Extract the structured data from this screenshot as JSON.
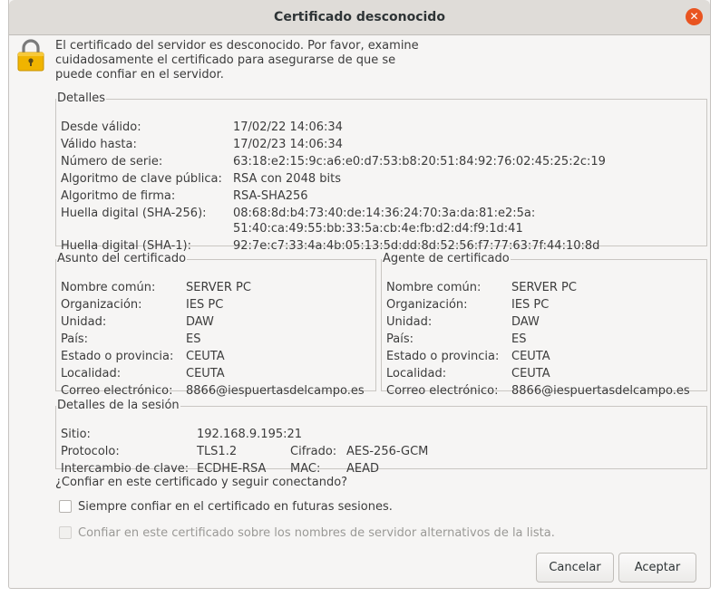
{
  "window": {
    "title": "Certificado desconocido"
  },
  "intro": [
    "El certificado del servidor es desconocido. Por favor, examine",
    "cuidadosamente el certificado para asegurarse de que se",
    "puede confiar en el servidor."
  ],
  "details": {
    "legend": "Detalles",
    "rows": [
      {
        "label": "Desde válido:",
        "value": "17/02/22 14:06:34"
      },
      {
        "label": "Válido hasta:",
        "value": "17/02/23 14:06:34"
      },
      {
        "label": "Número de serie:",
        "value": "63:18:e2:15:9c:a6:e0:d7:53:b8:20:51:84:92:76:02:45:25:2c:19"
      },
      {
        "label": "Algoritmo de clave pública:",
        "value": "RSA con 2048 bits"
      },
      {
        "label": "Algoritmo de firma:",
        "value": "RSA-SHA256"
      },
      {
        "label": "Huella digital (SHA-256):",
        "value": "08:68:8d:b4:73:40:de:14:36:24:70:3a:da:81:e2:5a:",
        "value2": "51:40:ca:49:55:bb:33:5a:cb:4e:fb:d2:d4:f9:1d:41"
      },
      {
        "label": "Huella digital (SHA-1):",
        "value": "92:7e:c7:33:4a:4b:05:13:5d:dd:8d:52:56:f7:77:63:7f:44:10:8d"
      }
    ]
  },
  "subject": {
    "legend": "Asunto del certificado",
    "rows": [
      {
        "label": "Nombre común:",
        "value": "SERVER PC"
      },
      {
        "label": "Organización:",
        "value": "IES PC"
      },
      {
        "label": "Unidad:",
        "value": "DAW"
      },
      {
        "label": "País:",
        "value": "ES"
      },
      {
        "label": "Estado o provincia:",
        "value": "CEUTA"
      },
      {
        "label": "Localidad:",
        "value": "CEUTA"
      },
      {
        "label": "Correo electrónico:",
        "value": "8866@iespuertasdelcampo.es"
      }
    ]
  },
  "issuer": {
    "legend": "Agente de certificado",
    "rows": [
      {
        "label": "Nombre común:",
        "value": "SERVER PC"
      },
      {
        "label": "Organización:",
        "value": "IES PC"
      },
      {
        "label": "Unidad:",
        "value": "DAW"
      },
      {
        "label": "País:",
        "value": "ES"
      },
      {
        "label": "Estado o provincia:",
        "value": "CEUTA"
      },
      {
        "label": "Localidad:",
        "value": "CEUTA"
      },
      {
        "label": "Correo electrónico:",
        "value": "8866@iespuertasdelcampo.es"
      }
    ]
  },
  "session": {
    "legend": "Detalles de la sesión",
    "site_label": "Sitio:",
    "site_value": "192.168.9.195:21",
    "protocol_label": "Protocolo:",
    "protocol_value": "TLS1.2",
    "cipher_label": "Cifrado:",
    "cipher_value": "AES-256-GCM",
    "kex_label": "Intercambio de clave:",
    "kex_value": "ECDHE-RSA",
    "mac_label": "MAC:",
    "mac_value": "AEAD"
  },
  "question": "¿Confiar en este certificado y seguir conectando?",
  "checkboxes": [
    {
      "label": "Siempre confiar en el certificado en futuras sesiones.",
      "checked": false,
      "enabled": true
    },
    {
      "label": "Confiar en este certificado sobre los nombres de servidor alternativos de la lista.",
      "checked": false,
      "enabled": false
    }
  ],
  "buttons": {
    "cancel": "Cancelar",
    "accept": "Aceptar"
  },
  "icons": {
    "lock": "lock-icon",
    "close": "close-icon"
  },
  "colors": {
    "close_button": "#e95420",
    "lock_body": "#f0b400",
    "title_bar": "#dfdcd8"
  }
}
